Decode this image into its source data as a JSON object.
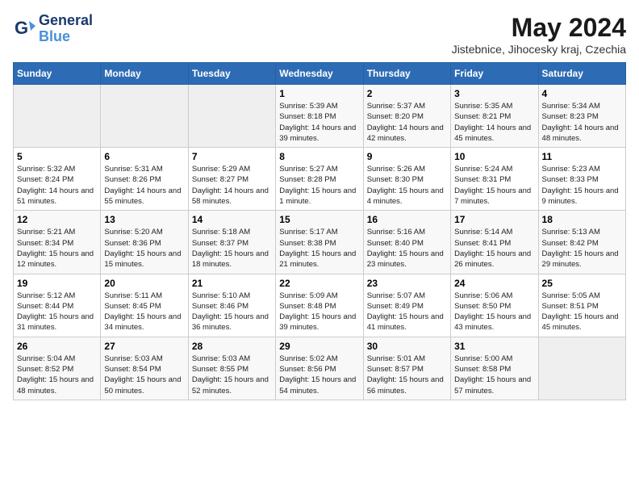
{
  "header": {
    "logo_line1": "General",
    "logo_line2": "Blue",
    "month_title": "May 2024",
    "location": "Jistebnice, Jihocesky kraj, Czechia"
  },
  "days_of_week": [
    "Sunday",
    "Monday",
    "Tuesday",
    "Wednesday",
    "Thursday",
    "Friday",
    "Saturday"
  ],
  "weeks": [
    [
      {
        "day": "",
        "info": ""
      },
      {
        "day": "",
        "info": ""
      },
      {
        "day": "",
        "info": ""
      },
      {
        "day": "1",
        "info": "Sunrise: 5:39 AM\nSunset: 8:18 PM\nDaylight: 14 hours and 39 minutes."
      },
      {
        "day": "2",
        "info": "Sunrise: 5:37 AM\nSunset: 8:20 PM\nDaylight: 14 hours and 42 minutes."
      },
      {
        "day": "3",
        "info": "Sunrise: 5:35 AM\nSunset: 8:21 PM\nDaylight: 14 hours and 45 minutes."
      },
      {
        "day": "4",
        "info": "Sunrise: 5:34 AM\nSunset: 8:23 PM\nDaylight: 14 hours and 48 minutes."
      }
    ],
    [
      {
        "day": "5",
        "info": "Sunrise: 5:32 AM\nSunset: 8:24 PM\nDaylight: 14 hours and 51 minutes."
      },
      {
        "day": "6",
        "info": "Sunrise: 5:31 AM\nSunset: 8:26 PM\nDaylight: 14 hours and 55 minutes."
      },
      {
        "day": "7",
        "info": "Sunrise: 5:29 AM\nSunset: 8:27 PM\nDaylight: 14 hours and 58 minutes."
      },
      {
        "day": "8",
        "info": "Sunrise: 5:27 AM\nSunset: 8:28 PM\nDaylight: 15 hours and 1 minute."
      },
      {
        "day": "9",
        "info": "Sunrise: 5:26 AM\nSunset: 8:30 PM\nDaylight: 15 hours and 4 minutes."
      },
      {
        "day": "10",
        "info": "Sunrise: 5:24 AM\nSunset: 8:31 PM\nDaylight: 15 hours and 7 minutes."
      },
      {
        "day": "11",
        "info": "Sunrise: 5:23 AM\nSunset: 8:33 PM\nDaylight: 15 hours and 9 minutes."
      }
    ],
    [
      {
        "day": "12",
        "info": "Sunrise: 5:21 AM\nSunset: 8:34 PM\nDaylight: 15 hours and 12 minutes."
      },
      {
        "day": "13",
        "info": "Sunrise: 5:20 AM\nSunset: 8:36 PM\nDaylight: 15 hours and 15 minutes."
      },
      {
        "day": "14",
        "info": "Sunrise: 5:18 AM\nSunset: 8:37 PM\nDaylight: 15 hours and 18 minutes."
      },
      {
        "day": "15",
        "info": "Sunrise: 5:17 AM\nSunset: 8:38 PM\nDaylight: 15 hours and 21 minutes."
      },
      {
        "day": "16",
        "info": "Sunrise: 5:16 AM\nSunset: 8:40 PM\nDaylight: 15 hours and 23 minutes."
      },
      {
        "day": "17",
        "info": "Sunrise: 5:14 AM\nSunset: 8:41 PM\nDaylight: 15 hours and 26 minutes."
      },
      {
        "day": "18",
        "info": "Sunrise: 5:13 AM\nSunset: 8:42 PM\nDaylight: 15 hours and 29 minutes."
      }
    ],
    [
      {
        "day": "19",
        "info": "Sunrise: 5:12 AM\nSunset: 8:44 PM\nDaylight: 15 hours and 31 minutes."
      },
      {
        "day": "20",
        "info": "Sunrise: 5:11 AM\nSunset: 8:45 PM\nDaylight: 15 hours and 34 minutes."
      },
      {
        "day": "21",
        "info": "Sunrise: 5:10 AM\nSunset: 8:46 PM\nDaylight: 15 hours and 36 minutes."
      },
      {
        "day": "22",
        "info": "Sunrise: 5:09 AM\nSunset: 8:48 PM\nDaylight: 15 hours and 39 minutes."
      },
      {
        "day": "23",
        "info": "Sunrise: 5:07 AM\nSunset: 8:49 PM\nDaylight: 15 hours and 41 minutes."
      },
      {
        "day": "24",
        "info": "Sunrise: 5:06 AM\nSunset: 8:50 PM\nDaylight: 15 hours and 43 minutes."
      },
      {
        "day": "25",
        "info": "Sunrise: 5:05 AM\nSunset: 8:51 PM\nDaylight: 15 hours and 45 minutes."
      }
    ],
    [
      {
        "day": "26",
        "info": "Sunrise: 5:04 AM\nSunset: 8:52 PM\nDaylight: 15 hours and 48 minutes."
      },
      {
        "day": "27",
        "info": "Sunrise: 5:03 AM\nSunset: 8:54 PM\nDaylight: 15 hours and 50 minutes."
      },
      {
        "day": "28",
        "info": "Sunrise: 5:03 AM\nSunset: 8:55 PM\nDaylight: 15 hours and 52 minutes."
      },
      {
        "day": "29",
        "info": "Sunrise: 5:02 AM\nSunset: 8:56 PM\nDaylight: 15 hours and 54 minutes."
      },
      {
        "day": "30",
        "info": "Sunrise: 5:01 AM\nSunset: 8:57 PM\nDaylight: 15 hours and 56 minutes."
      },
      {
        "day": "31",
        "info": "Sunrise: 5:00 AM\nSunset: 8:58 PM\nDaylight: 15 hours and 57 minutes."
      },
      {
        "day": "",
        "info": ""
      }
    ]
  ]
}
